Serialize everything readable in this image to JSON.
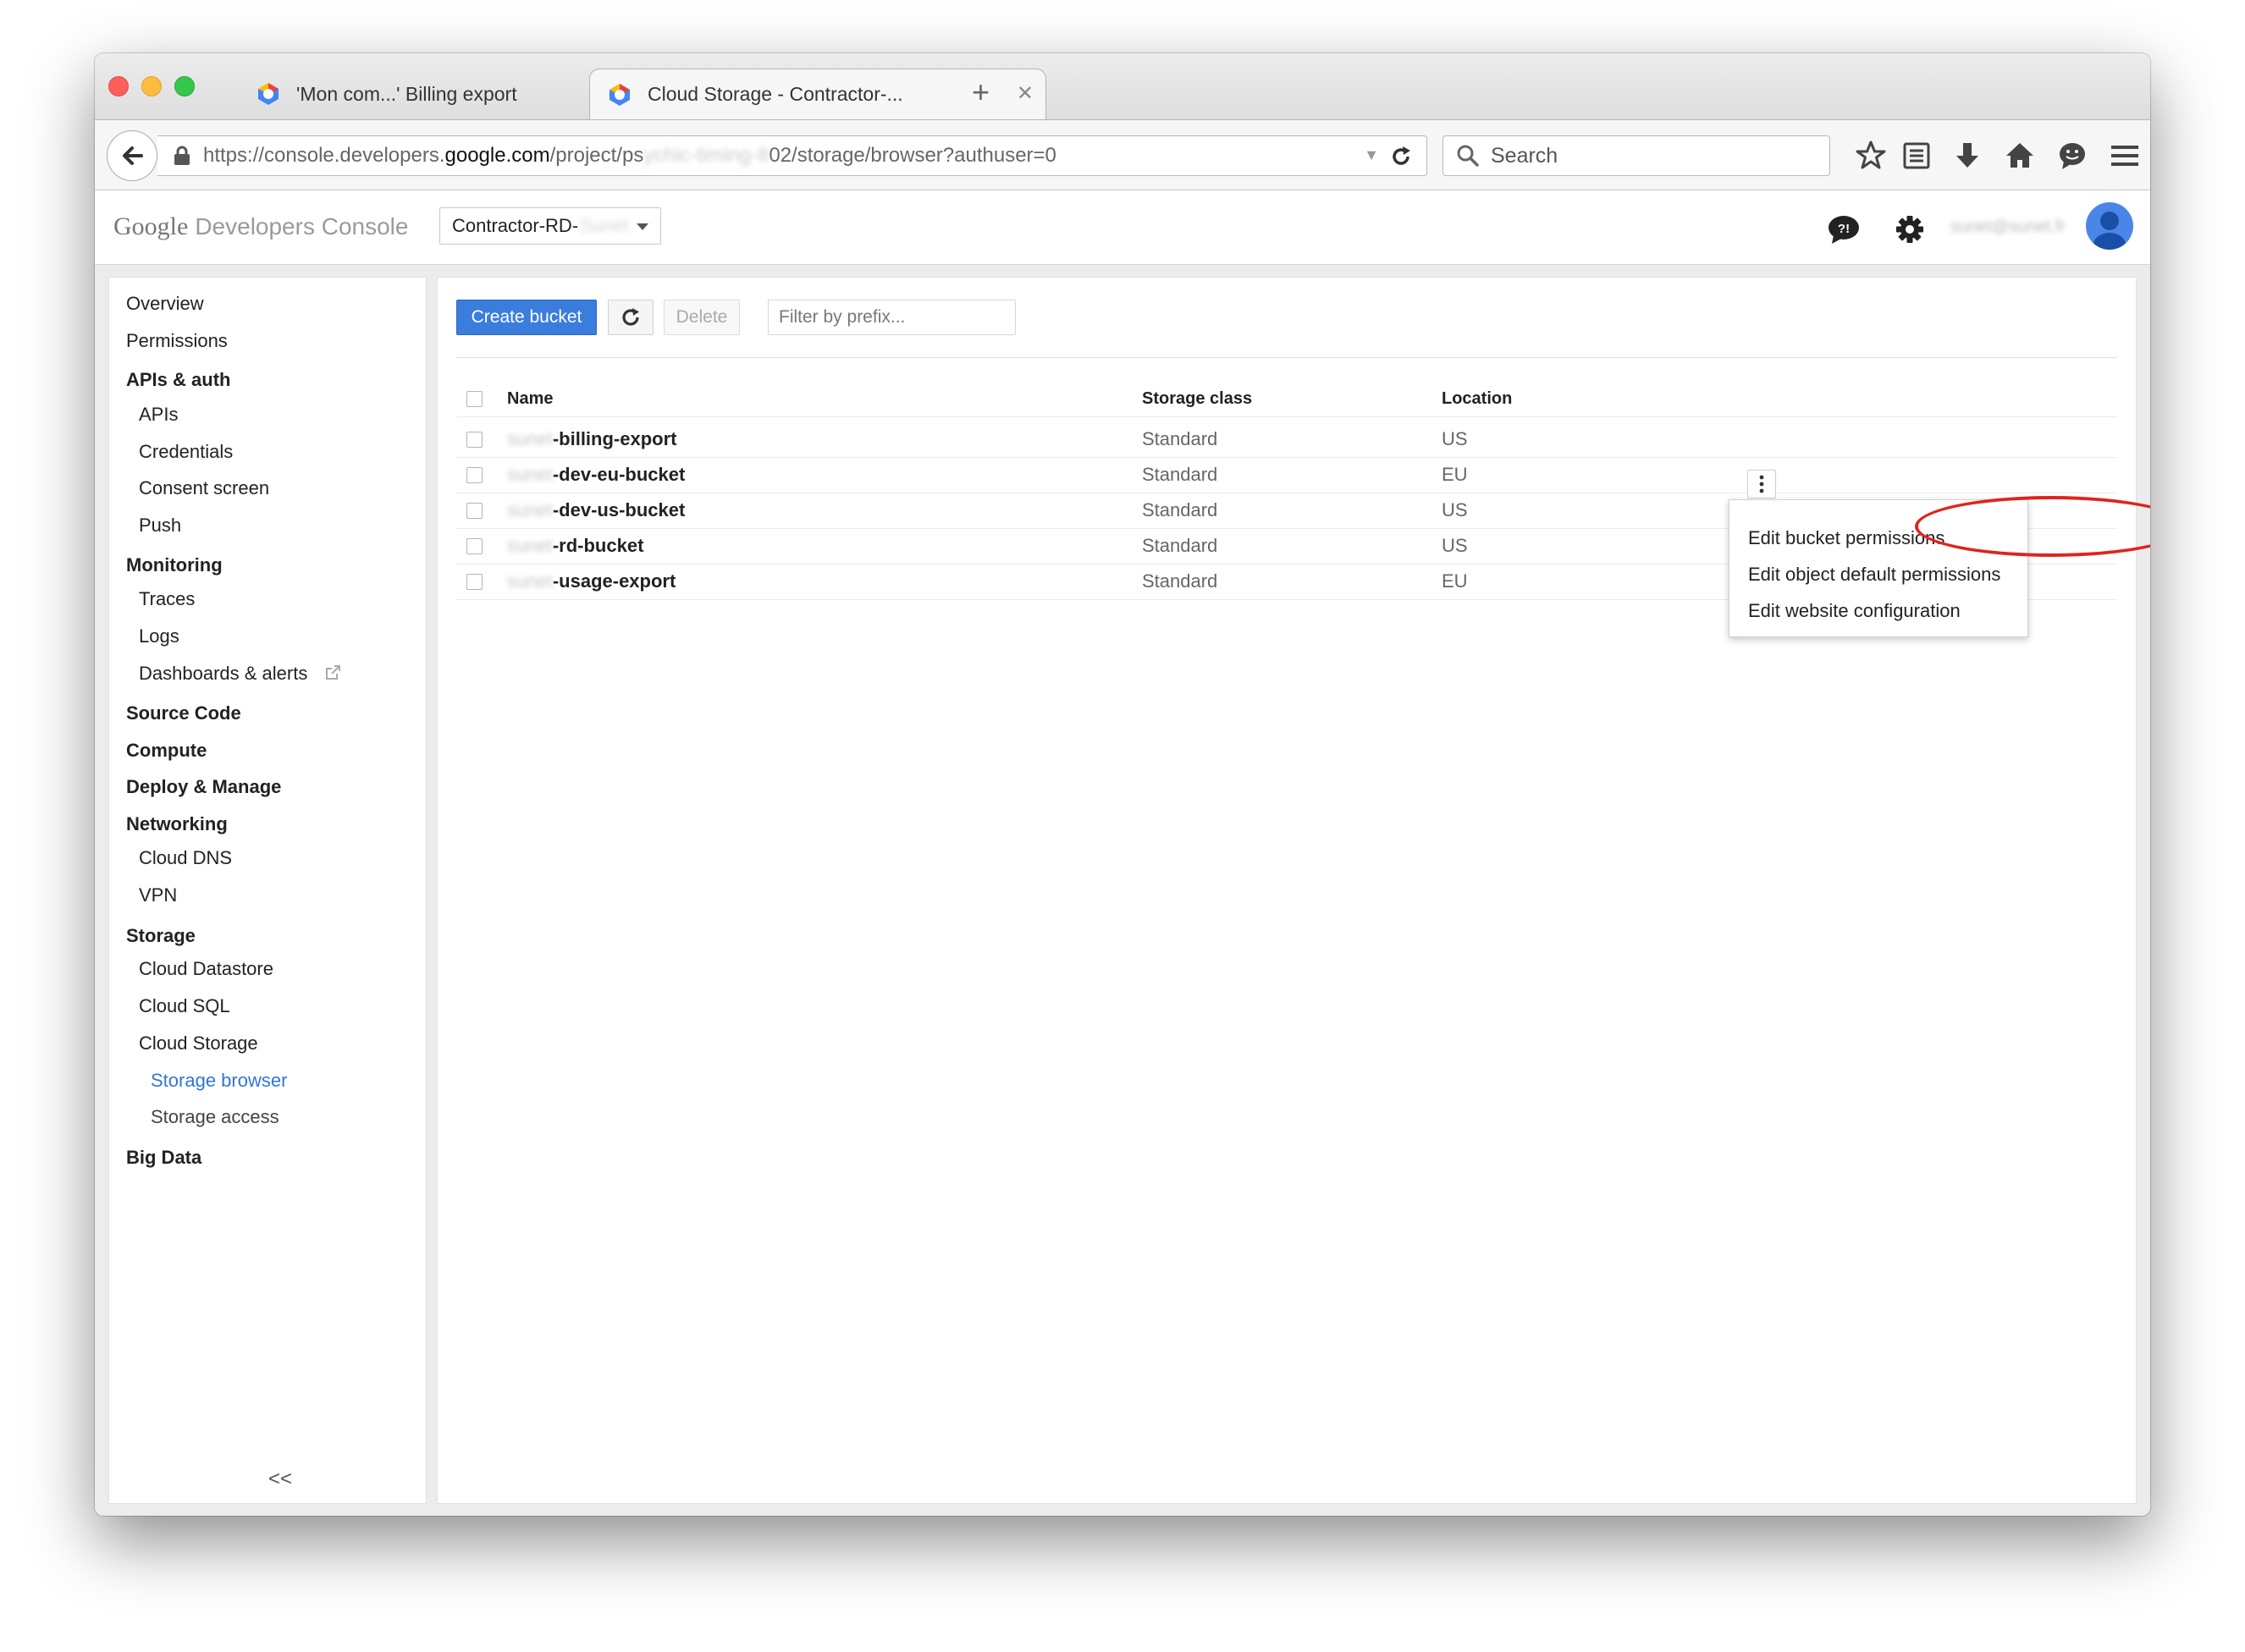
{
  "browser": {
    "tabs": [
      {
        "title": "'Mon com...' Billing export",
        "active": false
      },
      {
        "title": "Cloud Storage - Contractor-...",
        "active": true
      }
    ],
    "url": {
      "prefix": "https://console.developers.",
      "domain": "google.com",
      "path_start": "/project/ps",
      "path_blurred": "ychic-timing-8",
      "path_end": "02/storage/browser?authuser=0"
    },
    "search_placeholder": "Search"
  },
  "console": {
    "brand_google": "Google",
    "brand_product": "Developers Console",
    "project": {
      "name": "Contractor-RD-",
      "name_blurred": "Sunet"
    },
    "account_email_blurred": "sunet@sunet.fr"
  },
  "sidebar": {
    "items": [
      {
        "label": "Overview",
        "level": 1
      },
      {
        "label": "Permissions",
        "level": 1
      },
      {
        "label": "APIs & auth",
        "level": 1,
        "section": true
      },
      {
        "label": "APIs",
        "level": 2
      },
      {
        "label": "Credentials",
        "level": 2
      },
      {
        "label": "Consent screen",
        "level": 2
      },
      {
        "label": "Push",
        "level": 2
      },
      {
        "label": "Monitoring",
        "level": 1,
        "section": true
      },
      {
        "label": "Traces",
        "level": 2
      },
      {
        "label": "Logs",
        "level": 2
      },
      {
        "label": "Dashboards & alerts",
        "level": 2,
        "external": true
      },
      {
        "label": "Source Code",
        "level": 1,
        "section": true
      },
      {
        "label": "Compute",
        "level": 1,
        "section": true
      },
      {
        "label": "Deploy & Manage",
        "level": 1,
        "section": true
      },
      {
        "label": "Networking",
        "level": 1,
        "section": true
      },
      {
        "label": "Cloud DNS",
        "level": 2
      },
      {
        "label": "VPN",
        "level": 2
      },
      {
        "label": "Storage",
        "level": 1,
        "section": true
      },
      {
        "label": "Cloud Datastore",
        "level": 2
      },
      {
        "label": "Cloud SQL",
        "level": 2
      },
      {
        "label": "Cloud Storage",
        "level": 2
      },
      {
        "label": "Storage browser",
        "level": 3,
        "active": true
      },
      {
        "label": "Storage access",
        "level": 3
      },
      {
        "label": "Big Data",
        "level": 1,
        "section": true
      }
    ],
    "collapse_label": "<<"
  },
  "toolbar": {
    "create_label": "Create bucket",
    "delete_label": "Delete",
    "filter_placeholder": "Filter by prefix..."
  },
  "table": {
    "columns": [
      "Name",
      "Storage class",
      "Location"
    ],
    "rows": [
      {
        "prefix_blurred": "sunet",
        "name": "-billing-export",
        "storage_class": "Standard",
        "location": "US"
      },
      {
        "prefix_blurred": "sunet",
        "name": "-dev-eu-bucket",
        "storage_class": "Standard",
        "location": "EU"
      },
      {
        "prefix_blurred": "sunet",
        "name": "-dev-us-bucket",
        "storage_class": "Standard",
        "location": "US"
      },
      {
        "prefix_blurred": "sunet",
        "name": "-rd-bucket",
        "storage_class": "Standard",
        "location": "US"
      },
      {
        "prefix_blurred": "sunet",
        "name": "-usage-export",
        "storage_class": "Standard",
        "location": "EU"
      }
    ]
  },
  "context_menu": {
    "items": [
      "Edit bucket permissions",
      "Edit object default permissions",
      "Edit website configuration"
    ],
    "highlighted_index": 0
  },
  "colors": {
    "primary_button": "#3b7ddd",
    "active_link": "#3275d9",
    "annotation": "#e0241b"
  }
}
